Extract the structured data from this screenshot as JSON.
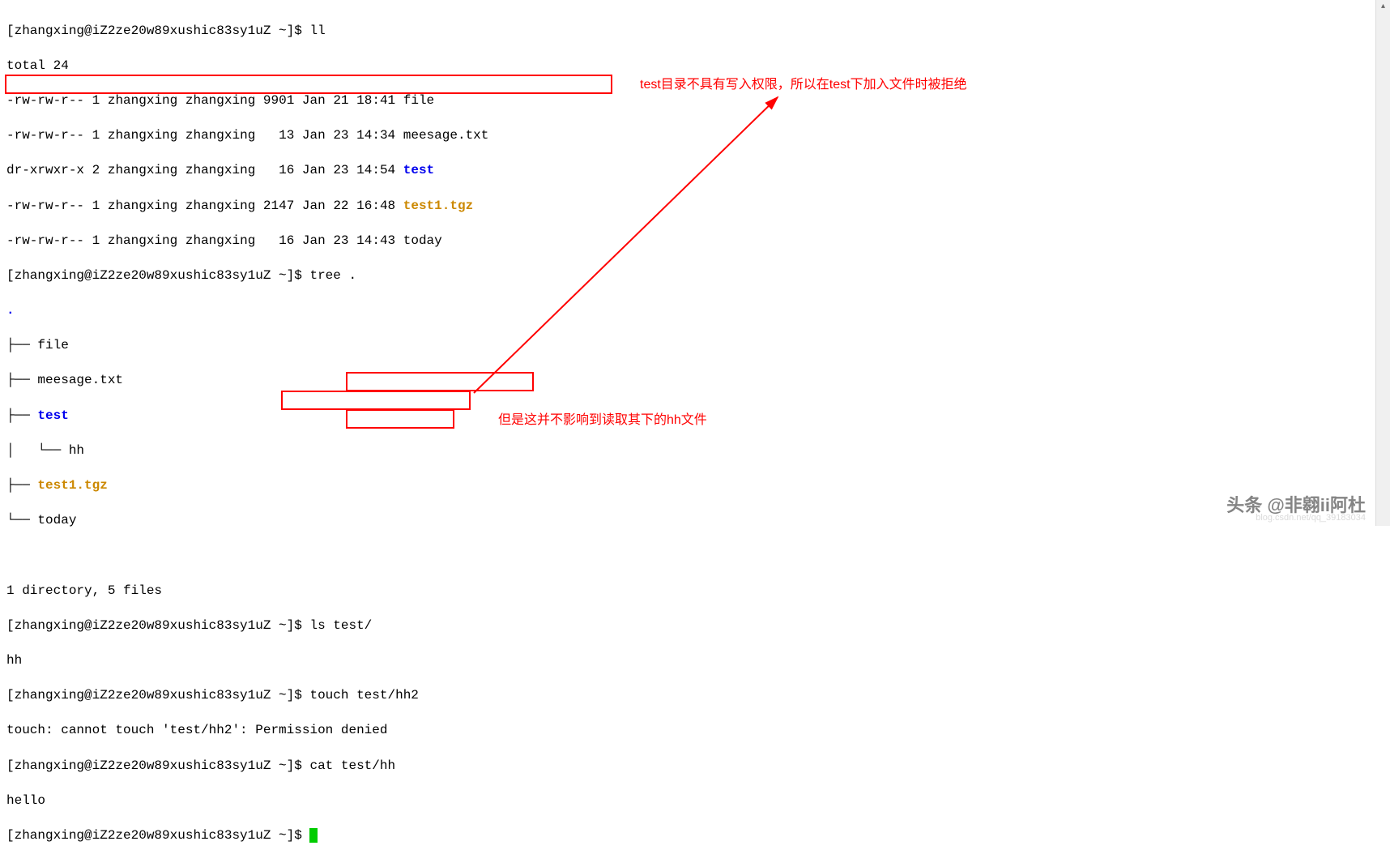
{
  "prompt": "[zhangxing@iZ2ze20w89xushic83sy1uZ ~]$ ",
  "cmd_ll": "ll",
  "ll_total": "total 24",
  "ll_rows": [
    {
      "perm": "-rw-rw-r--",
      "links": "1",
      "owner": "zhangxing",
      "group": "zhangxing",
      "size": "9901",
      "date": "Jan 21 18:41",
      "name": "file",
      "cls": ""
    },
    {
      "perm": "-rw-rw-r--",
      "links": "1",
      "owner": "zhangxing",
      "group": "zhangxing",
      "size": "  13",
      "date": "Jan 23 14:34",
      "name": "meesage.txt",
      "cls": ""
    },
    {
      "perm": "dr-xrwxr-x",
      "links": "2",
      "owner": "zhangxing",
      "group": "zhangxing",
      "size": "  16",
      "date": "Jan 23 14:54",
      "name": "test",
      "cls": "blue"
    },
    {
      "perm": "-rw-rw-r--",
      "links": "1",
      "owner": "zhangxing",
      "group": "zhangxing",
      "size": "2147",
      "date": "Jan 22 16:48",
      "name": "test1.tgz",
      "cls": "orange"
    },
    {
      "perm": "-rw-rw-r--",
      "links": "1",
      "owner": "zhangxing",
      "group": "zhangxing",
      "size": "  16",
      "date": "Jan 23 14:43",
      "name": "today",
      "cls": ""
    }
  ],
  "cmd_tree": "tree .",
  "tree_dot": ".",
  "tree_l1": "├── file",
  "tree_l2": "├── meesage.txt",
  "tree_l3p": "├── ",
  "tree_l3n": "test",
  "tree_l4": "│   └── hh",
  "tree_l5p": "├── ",
  "tree_l5n": "test1.tgz",
  "tree_l6": "└── today",
  "tree_summary": "1 directory, 5 files",
  "cmd_ls": "ls test/",
  "ls_out": "hh",
  "cmd_touch": "touch test/hh2",
  "touch_err_a": "touch: cannot touch 'test/hh2': ",
  "touch_err_b": "Permission denied",
  "cmd_cat": "cat test/hh",
  "cat_out": "hello",
  "annotation1": "test目录不具有写入权限，所以在test下加入文件时被拒绝",
  "annotation2": "但是这并不影响到读取其下的hh文件",
  "watermark": "头条 @非翱ii阿杜",
  "watermark2": "blog.csdn.net/qq_39183034"
}
